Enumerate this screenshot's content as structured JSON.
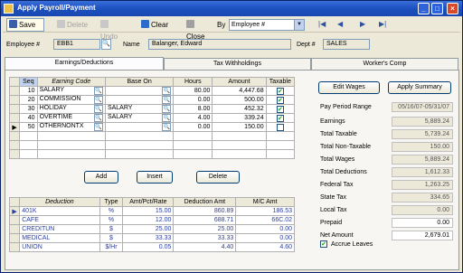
{
  "window": {
    "title": "Apply Payroll/Payment"
  },
  "toolbar": {
    "save": "Save",
    "delete": "Delete",
    "undo": "Undo",
    "clear": "Clear",
    "close": "Close",
    "by_label": "By",
    "by_value": "Employee #"
  },
  "header": {
    "employee_label": "Employee #",
    "employee_value": "EBB1",
    "name_label": "Name",
    "name_value": "Balanger, Edward",
    "dept_label": "Dept #",
    "dept_value": "SALES"
  },
  "tabs": [
    "Earnings/Deductions",
    "Tax Withholdings",
    "Worker's Comp"
  ],
  "earnings": {
    "headers": [
      "Seq",
      "Earning Code",
      "Base On",
      "Hours",
      "Amount",
      "Taxable"
    ],
    "rows": [
      {
        "seq": "10",
        "code": "SALARY",
        "base": "",
        "hours": "80.00",
        "amount": "4,447.68",
        "taxable": true
      },
      {
        "seq": "20",
        "code": "COMMISSION",
        "base": "",
        "hours": "0.00",
        "amount": "500.00",
        "taxable": true
      },
      {
        "seq": "30",
        "code": "HOLIDAY",
        "base": "SALARY",
        "hours": "8.00",
        "amount": "452.32",
        "taxable": true
      },
      {
        "seq": "40",
        "code": "OVERTIME",
        "base": "SALARY",
        "hours": "4.00",
        "amount": "339.24",
        "taxable": true
      },
      {
        "seq": "50",
        "code": "OTHERNONTX",
        "base": "",
        "hours": "0.00",
        "amount": "150.00",
        "taxable": false
      }
    ]
  },
  "buttons": {
    "add": "Add",
    "insert": "Insert",
    "delete": "Delete",
    "edit_wages": "Edit Wages",
    "apply_summary": "Apply Summary"
  },
  "deductions": {
    "headers": [
      "Deduction",
      "Type",
      "Amt/Pct/Rate",
      "Deduction Amt",
      "M/C Amt"
    ],
    "rows": [
      {
        "name": "401K",
        "type": "%",
        "rate": "15.00",
        "amt": "860.89",
        "mc": "186.53"
      },
      {
        "name": "CAFE",
        "type": "%",
        "rate": "12.00",
        "amt": "688.71",
        "mc": "66C.02"
      },
      {
        "name": "CREDITUN",
        "type": "$",
        "rate": "25.00",
        "amt": "25.00",
        "mc": "0.00"
      },
      {
        "name": "MEDICAL",
        "type": "$",
        "rate": "33.33",
        "amt": "33.33",
        "mc": "0.00"
      },
      {
        "name": "UNION",
        "type": "$/Hr",
        "rate": "0.05",
        "amt": "4.40",
        "mc": "4.60"
      }
    ]
  },
  "summary": {
    "pay_period_label": "Pay Period Range",
    "pay_period_value": "05/16/07-05/31/07",
    "items": [
      {
        "label": "Earnings",
        "value": "5,889.24"
      },
      {
        "label": "Total Taxable",
        "value": "5,739.24"
      },
      {
        "label": "Total Non-Taxable",
        "value": "150.00"
      },
      {
        "label": "Total Wages",
        "value": "5,889.24"
      },
      {
        "label": "Total Deductions",
        "value": "1,612.33"
      },
      {
        "label": "Federal Tax",
        "value": "1,263.25"
      },
      {
        "label": "State Tax",
        "value": "334.65"
      },
      {
        "label": "Local Tax",
        "value": "0.00"
      },
      {
        "label": "Prepaid",
        "value": "0.00"
      },
      {
        "label": "Net Amount",
        "value": "2,679.01"
      }
    ],
    "accrue_label": "Accrue Leaves"
  },
  "colors": {
    "title_bar": "#1c50c0",
    "close_button": "#d84a2a",
    "deduction_text": "#2a3fa0"
  }
}
